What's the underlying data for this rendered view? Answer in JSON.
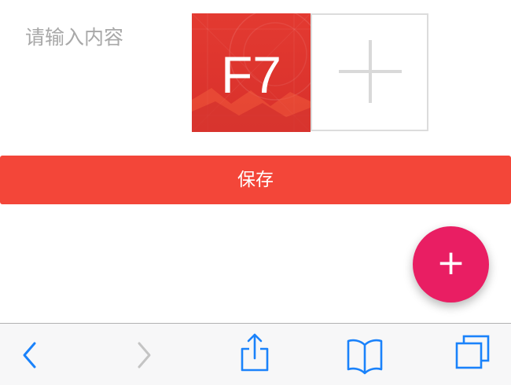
{
  "form": {
    "input_placeholder": "请输入内容",
    "image_thumbnail_text": "F7",
    "add_image_icon": "plus-icon",
    "save_label": "保存"
  },
  "fab": {
    "icon": "plus-icon",
    "glyph": "+"
  },
  "browser_toolbar": {
    "items": [
      {
        "icon": "back-icon",
        "enabled": true
      },
      {
        "icon": "forward-icon",
        "enabled": false
      },
      {
        "icon": "share-icon",
        "enabled": true
      },
      {
        "icon": "bookmarks-icon",
        "enabled": true
      },
      {
        "icon": "tabs-icon",
        "enabled": true
      }
    ]
  },
  "colors": {
    "save_button": "#f34639",
    "fab": "#e91e63",
    "thumbnail": "#e0362f",
    "toolbar_icon": "#1a82fb",
    "toolbar_icon_disabled": "#c4c4c4",
    "placeholder_text": "#a8a8a8"
  }
}
